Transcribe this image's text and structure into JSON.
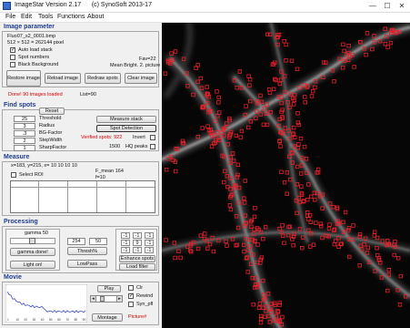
{
  "window": {
    "title": "ImageStar Version 2.17      (c) SynoSoft 2013-17",
    "minimize": "—",
    "maximize": "☐",
    "close": "✕"
  },
  "menu": [
    "File",
    "Edit",
    "Tools",
    "Functions",
    "About"
  ],
  "image_param": {
    "header": "Image parameter",
    "filename": "Fluo07_s2_0001.bmp",
    "dims": "512 × 512 = 262144 pixel",
    "fav": "Fav=22",
    "mean_bright": "Mean Bright. 2. picture",
    "auto_load": {
      "label": "Auto load stack",
      "checked": true
    },
    "spot_numbers": {
      "label": "Spot numbers",
      "checked": false
    },
    "black_bg": {
      "label": "Black Background",
      "checked": false
    },
    "buttons": [
      "Restore image",
      "Reload image",
      "Redraw spots",
      "Clear image"
    ],
    "status": "Done! 90 images loaded",
    "list": "List=90"
  },
  "find_spots": {
    "header": "Find spots",
    "reset": "Reset",
    "params": [
      {
        "value": "25",
        "label": "Threshold"
      },
      {
        "value": "3",
        "label": "Radius"
      },
      {
        "value": ".3",
        "label": "BG-Factor"
      },
      {
        "value": "2",
        "label": "StepWidth"
      },
      {
        "value": "1",
        "label": "SharpFactor"
      }
    ],
    "measure_stack": "Measure stack",
    "spot_detection": "Spot Detection",
    "verified": "Verified spots: 922",
    "invert": {
      "label": "Invert",
      "checked": false
    },
    "hq": {
      "value": "1500",
      "label": "HQ peaks",
      "checked": false
    }
  },
  "measure": {
    "header": "Measure",
    "coords": "x=183, y=215, x= 10 10 10 10",
    "f_mean": "F_mean 164",
    "f": "f=10",
    "select_roi": {
      "label": "Select ROI",
      "checked": false
    }
  },
  "processing": {
    "header": "Processing",
    "gamma": "gamma 50",
    "gamma_done": "gamma done!",
    "thresh_low": "254",
    "thresh_high": "50",
    "thresh_btn": "Thresh%",
    "light_on": "Light on!",
    "lowpass": "LowPass",
    "matrix": [
      "-1",
      "-1",
      "-1",
      "-1",
      "9",
      "-1",
      "-1",
      "-1",
      "-1"
    ],
    "enhance": "Enhance spots",
    "load_filter": "Load filter"
  },
  "movie": {
    "header": "Movie",
    "play": "Play",
    "montage": "Montage",
    "picture_label": "Picture#",
    "clr": {
      "label": "Clr",
      "checked": false
    },
    "rewind": {
      "label": "Rewind",
      "checked": true
    },
    "syn_pfl": {
      "label": "Syn_pfl",
      "checked": false
    },
    "x_ticks": [
      "1",
      "10",
      "20",
      "30",
      "40",
      "50",
      "60",
      "70",
      "80",
      "90"
    ]
  },
  "colors": {
    "accent_header": "#1f3b8c",
    "status_red": "#d40000",
    "spot_red": "#e8202a",
    "plot_line": "#2233cc"
  }
}
